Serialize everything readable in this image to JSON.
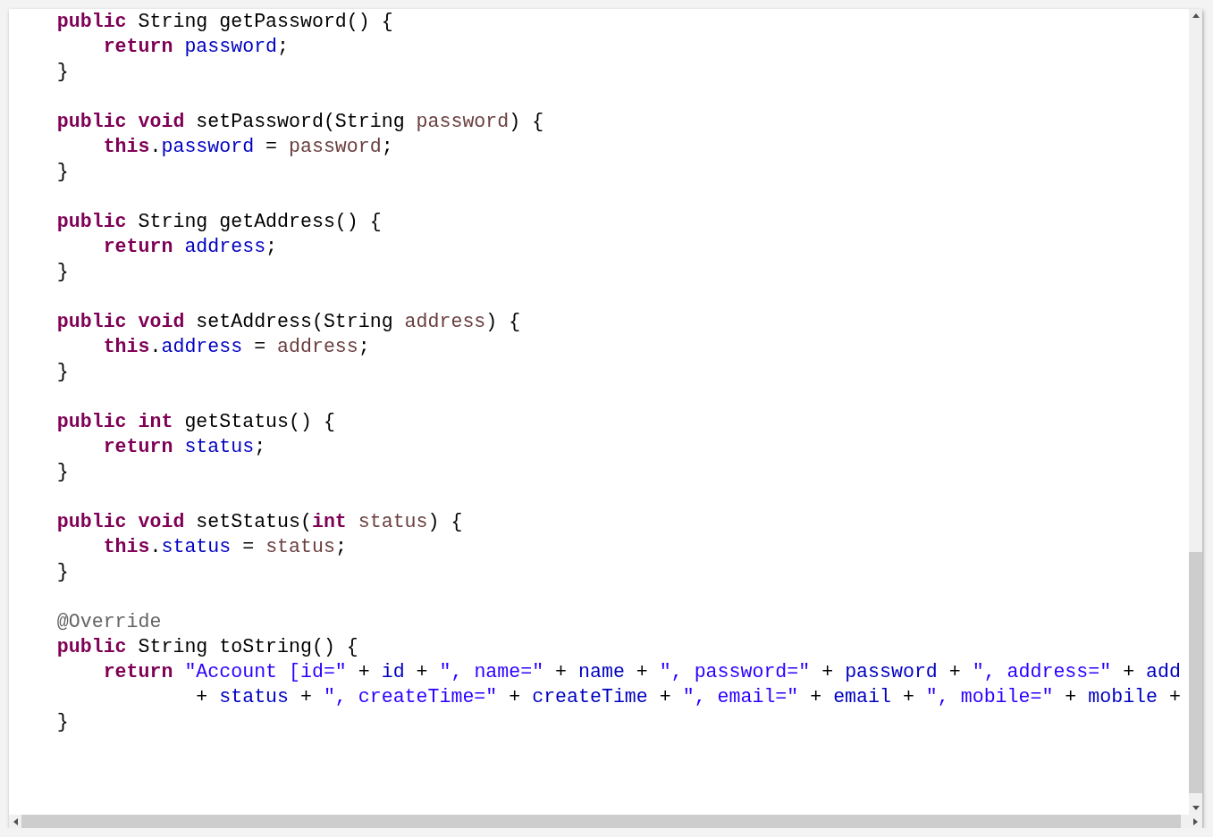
{
  "editor": {
    "blocks": [
      {
        "lines": [
          {
            "tokens": [
              {
                "kind": "keyword",
                "text": "public "
              },
              {
                "kind": "plain",
                "text": "String getPassword() {"
              }
            ],
            "children": [
              {
                "tokens": [
                  {
                    "kind": "keyword",
                    "text": "return "
                  },
                  {
                    "kind": "field",
                    "text": "password"
                  },
                  {
                    "kind": "plain",
                    "text": ";"
                  }
                ]
              }
            ]
          },
          {
            "tokens": [
              {
                "kind": "plain",
                "text": "}"
              }
            ]
          }
        ]
      },
      {
        "lines": [
          {
            "tokens": [
              {
                "kind": "keyword",
                "text": "public void "
              },
              {
                "kind": "plain",
                "text": "setPassword(String "
              },
              {
                "kind": "param",
                "text": "password"
              },
              {
                "kind": "plain",
                "text": ") {"
              }
            ],
            "children": [
              {
                "tokens": [
                  {
                    "kind": "keyword",
                    "text": "this"
                  },
                  {
                    "kind": "plain",
                    "text": "."
                  },
                  {
                    "kind": "field",
                    "text": "password"
                  },
                  {
                    "kind": "plain",
                    "text": " = "
                  },
                  {
                    "kind": "param",
                    "text": "password"
                  },
                  {
                    "kind": "plain",
                    "text": ";"
                  }
                ]
              }
            ]
          },
          {
            "tokens": [
              {
                "kind": "plain",
                "text": "}"
              }
            ]
          }
        ]
      },
      {
        "lines": [
          {
            "tokens": [
              {
                "kind": "keyword",
                "text": "public "
              },
              {
                "kind": "plain",
                "text": "String getAddress() {"
              }
            ],
            "children": [
              {
                "tokens": [
                  {
                    "kind": "keyword",
                    "text": "return "
                  },
                  {
                    "kind": "field",
                    "text": "address"
                  },
                  {
                    "kind": "plain",
                    "text": ";"
                  }
                ]
              }
            ]
          },
          {
            "tokens": [
              {
                "kind": "plain",
                "text": "}"
              }
            ]
          }
        ]
      },
      {
        "lines": [
          {
            "tokens": [
              {
                "kind": "keyword",
                "text": "public void "
              },
              {
                "kind": "plain",
                "text": "setAddress(String "
              },
              {
                "kind": "param",
                "text": "address"
              },
              {
                "kind": "plain",
                "text": ") {"
              }
            ],
            "children": [
              {
                "tokens": [
                  {
                    "kind": "keyword",
                    "text": "this"
                  },
                  {
                    "kind": "plain",
                    "text": "."
                  },
                  {
                    "kind": "field",
                    "text": "address"
                  },
                  {
                    "kind": "plain",
                    "text": " = "
                  },
                  {
                    "kind": "param",
                    "text": "address"
                  },
                  {
                    "kind": "plain",
                    "text": ";"
                  }
                ]
              }
            ]
          },
          {
            "tokens": [
              {
                "kind": "plain",
                "text": "}"
              }
            ]
          }
        ]
      },
      {
        "lines": [
          {
            "tokens": [
              {
                "kind": "keyword",
                "text": "public int "
              },
              {
                "kind": "plain",
                "text": "getStatus() {"
              }
            ],
            "children": [
              {
                "tokens": [
                  {
                    "kind": "keyword",
                    "text": "return "
                  },
                  {
                    "kind": "field",
                    "text": "status"
                  },
                  {
                    "kind": "plain",
                    "text": ";"
                  }
                ]
              }
            ]
          },
          {
            "tokens": [
              {
                "kind": "plain",
                "text": "}"
              }
            ]
          }
        ]
      },
      {
        "lines": [
          {
            "tokens": [
              {
                "kind": "keyword",
                "text": "public void "
              },
              {
                "kind": "plain",
                "text": "setStatus("
              },
              {
                "kind": "keyword",
                "text": "int "
              },
              {
                "kind": "param",
                "text": "status"
              },
              {
                "kind": "plain",
                "text": ") {"
              }
            ],
            "children": [
              {
                "tokens": [
                  {
                    "kind": "keyword",
                    "text": "this"
                  },
                  {
                    "kind": "plain",
                    "text": "."
                  },
                  {
                    "kind": "field",
                    "text": "status"
                  },
                  {
                    "kind": "plain",
                    "text": " = "
                  },
                  {
                    "kind": "param",
                    "text": "status"
                  },
                  {
                    "kind": "plain",
                    "text": ";"
                  }
                ]
              }
            ]
          },
          {
            "tokens": [
              {
                "kind": "plain",
                "text": "}"
              }
            ]
          }
        ]
      },
      {
        "lines": [
          {
            "tokens": [
              {
                "kind": "annotation",
                "text": "@Override"
              }
            ]
          },
          {
            "tokens": [
              {
                "kind": "keyword",
                "text": "public "
              },
              {
                "kind": "plain",
                "text": "String toString() {"
              }
            ],
            "children": [
              {
                "tokens": [
                  {
                    "kind": "keyword",
                    "text": "return "
                  },
                  {
                    "kind": "string",
                    "text": "\"Account [id=\""
                  },
                  {
                    "kind": "plain",
                    "text": " + "
                  },
                  {
                    "kind": "field",
                    "text": "id"
                  },
                  {
                    "kind": "plain",
                    "text": " + "
                  },
                  {
                    "kind": "string",
                    "text": "\", name=\""
                  },
                  {
                    "kind": "plain",
                    "text": " + "
                  },
                  {
                    "kind": "field",
                    "text": "name"
                  },
                  {
                    "kind": "plain",
                    "text": " + "
                  },
                  {
                    "kind": "string",
                    "text": "\", password=\""
                  },
                  {
                    "kind": "plain",
                    "text": " + "
                  },
                  {
                    "kind": "field",
                    "text": "password"
                  },
                  {
                    "kind": "plain",
                    "text": " + "
                  },
                  {
                    "kind": "string",
                    "text": "\", address=\""
                  },
                  {
                    "kind": "plain",
                    "text": " + "
                  },
                  {
                    "kind": "field",
                    "text": "add"
                  }
                ],
                "children": [
                  {
                    "kind": "continuation",
                    "tokens": [
                      {
                        "kind": "plain",
                        "text": "+ "
                      },
                      {
                        "kind": "field",
                        "text": "status"
                      },
                      {
                        "kind": "plain",
                        "text": " + "
                      },
                      {
                        "kind": "string",
                        "text": "\", createTime=\""
                      },
                      {
                        "kind": "plain",
                        "text": " + "
                      },
                      {
                        "kind": "field",
                        "text": "createTime"
                      },
                      {
                        "kind": "plain",
                        "text": " + "
                      },
                      {
                        "kind": "string",
                        "text": "\", email=\""
                      },
                      {
                        "kind": "plain",
                        "text": " + "
                      },
                      {
                        "kind": "field",
                        "text": "email"
                      },
                      {
                        "kind": "plain",
                        "text": " + "
                      },
                      {
                        "kind": "string",
                        "text": "\", mobile=\""
                      },
                      {
                        "kind": "plain",
                        "text": " + "
                      },
                      {
                        "kind": "field",
                        "text": "mobile"
                      },
                      {
                        "kind": "plain",
                        "text": " +"
                      }
                    ]
                  }
                ]
              }
            ]
          },
          {
            "tokens": [
              {
                "kind": "plain",
                "text": "}"
              }
            ]
          }
        ]
      }
    ]
  }
}
